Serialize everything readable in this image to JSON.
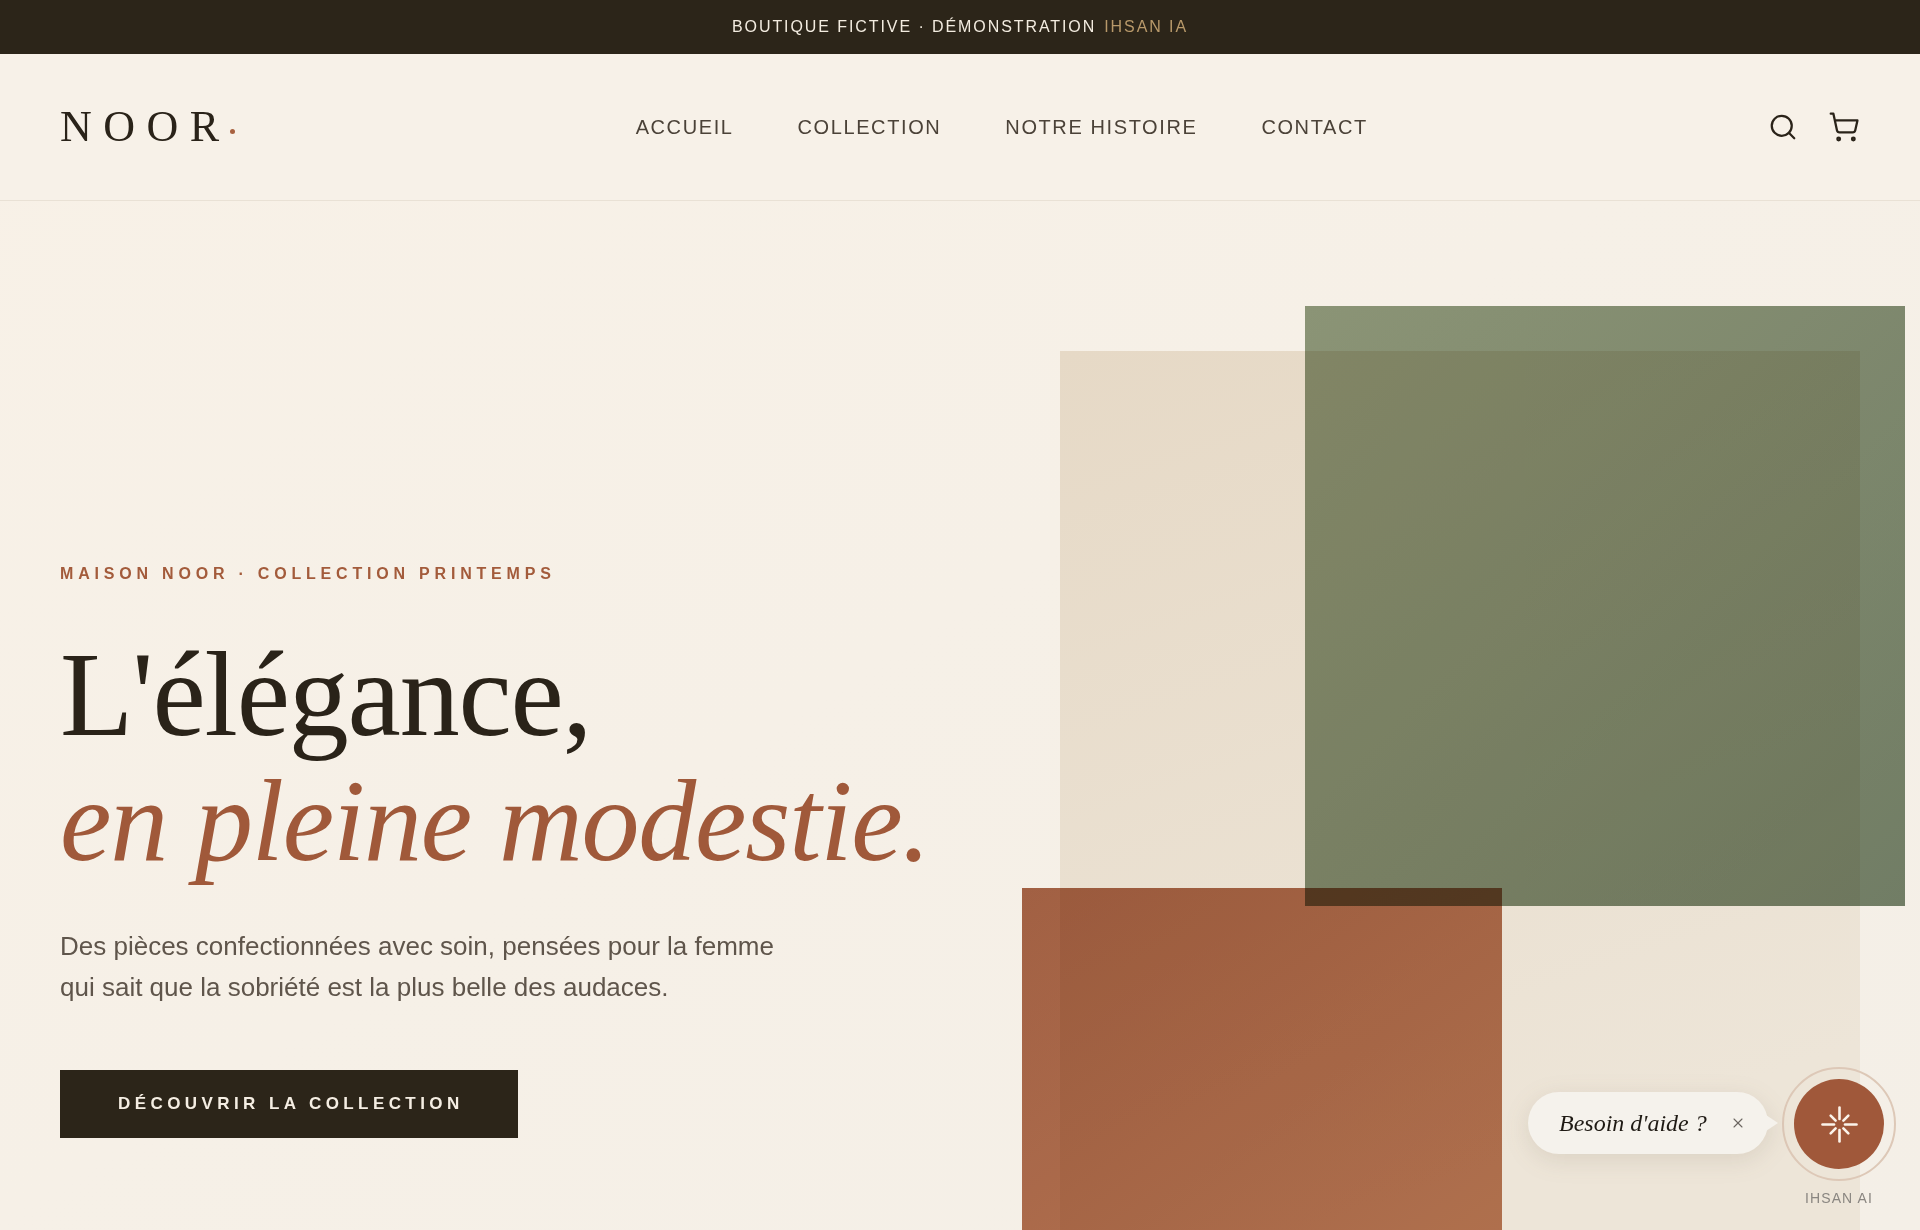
{
  "announcement": {
    "text": "BOUTIQUE FICTIVE · DÉMONSTRATION",
    "highlight": "IHSAN IA"
  },
  "header": {
    "logo": "NOOR",
    "nav": [
      "ACCUEIL",
      "COLLECTION",
      "NOTRE HISTOIRE",
      "CONTACT"
    ]
  },
  "hero": {
    "eyebrow": "MAISON NOOR · COLLECTION PRINTEMPS",
    "title": "L'élégance,",
    "title_accent": "en pleine modestie.",
    "description": "Des pièces confectionnées avec soin, pensées pour la femme qui sait que la sobriété est la plus belle des audaces.",
    "cta": "DÉCOUVRIR LA COLLECTION"
  },
  "assistant": {
    "prompt": "Besoin d'aide ?",
    "label": "IHSAN AI"
  }
}
